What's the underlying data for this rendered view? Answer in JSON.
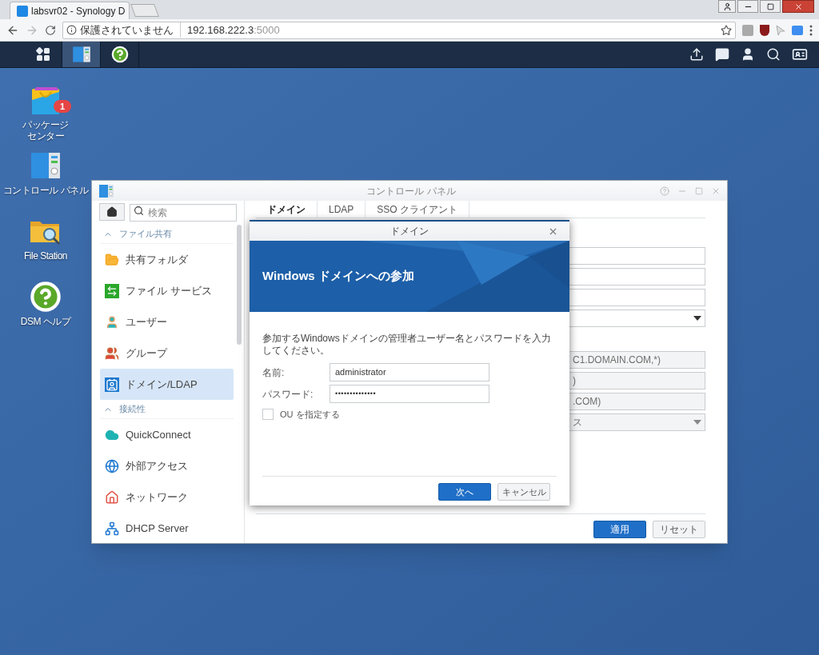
{
  "browser": {
    "tab_title": "labsvr02 - Synology D",
    "address": {
      "security": "保護されていません",
      "host": "192.168.222.3",
      "port": ":5000"
    }
  },
  "taskbar": {
    "apps": [
      {
        "kind": "grid",
        "selected": false
      },
      {
        "kind": "control-panel",
        "selected": true
      },
      {
        "kind": "help",
        "selected": false
      }
    ]
  },
  "desktop_icons": [
    {
      "kind": "package",
      "lines": [
        "パッケージ",
        "センター"
      ],
      "badge": "1"
    },
    {
      "kind": "control-panel",
      "lines": [
        "コントロール パネル"
      ]
    },
    {
      "kind": "folder",
      "lines": [
        "File Station"
      ]
    },
    {
      "kind": "help",
      "lines": [
        "DSM ヘルプ"
      ]
    }
  ],
  "control_panel": {
    "title": "コントロール パネル",
    "search": {
      "placeholder": "検索"
    },
    "sections": [
      {
        "title": "ファイル共有",
        "expanded": true,
        "items": [
          {
            "kind": "shared-folder",
            "label": "共有フォルダ",
            "selected": false
          },
          {
            "kind": "file-services",
            "label": "ファイル サービス",
            "selected": false
          },
          {
            "kind": "user",
            "label": "ユーザー",
            "selected": false
          },
          {
            "kind": "group",
            "label": "グループ",
            "selected": false
          },
          {
            "kind": "domain",
            "label": "ドメイン/LDAP",
            "selected": true
          }
        ]
      },
      {
        "title": "接続性",
        "expanded": true,
        "items": [
          {
            "kind": "quickconnect",
            "label": "QuickConnect",
            "selected": false
          },
          {
            "kind": "external",
            "label": "外部アクセス",
            "selected": false
          },
          {
            "kind": "network",
            "label": "ネットワーク",
            "selected": false
          },
          {
            "kind": "dhcp",
            "label": "DHCP Server",
            "selected": false
          }
        ]
      }
    ],
    "tabs": [
      {
        "label": "ドメイン",
        "selected": true
      },
      {
        "label": "LDAP",
        "selected": false
      },
      {
        "label": "SSO クライアント",
        "selected": false
      }
    ],
    "fields": [
      {
        "kind": "text",
        "disabled": false
      },
      {
        "kind": "text",
        "disabled": false
      },
      {
        "kind": "text",
        "disabled": false
      },
      {
        "kind": "select",
        "disabled": false
      },
      {
        "kind": "gap"
      },
      {
        "kind": "text",
        "value": "C1.DOMAIN.COM,*)",
        "disabled": true
      },
      {
        "kind": "text",
        "value": ")",
        "disabled": true
      },
      {
        "kind": "text",
        "value": ".COM)",
        "disabled": true
      },
      {
        "kind": "select",
        "value": "ス",
        "disabled": true
      }
    ],
    "buttons": [
      {
        "label": "適用",
        "primary": true
      },
      {
        "label": "リセット",
        "primary": false
      }
    ]
  },
  "dialog": {
    "title": "ドメイン",
    "banner": "Windows ドメインへの参加",
    "instruction": "参加するWindowsドメインの管理者ユーザー名とパスワードを入力してください。",
    "fields": [
      {
        "kind": "text",
        "label": "名前:",
        "value": "administrator"
      },
      {
        "kind": "password",
        "label": "パスワード:",
        "value": "••••••••••••••"
      }
    ],
    "checkbox": {
      "label": "OU を指定する",
      "checked": false
    },
    "buttons": [
      {
        "label": "次へ",
        "primary": true
      },
      {
        "label": "キャンセル",
        "primary": false
      }
    ]
  }
}
